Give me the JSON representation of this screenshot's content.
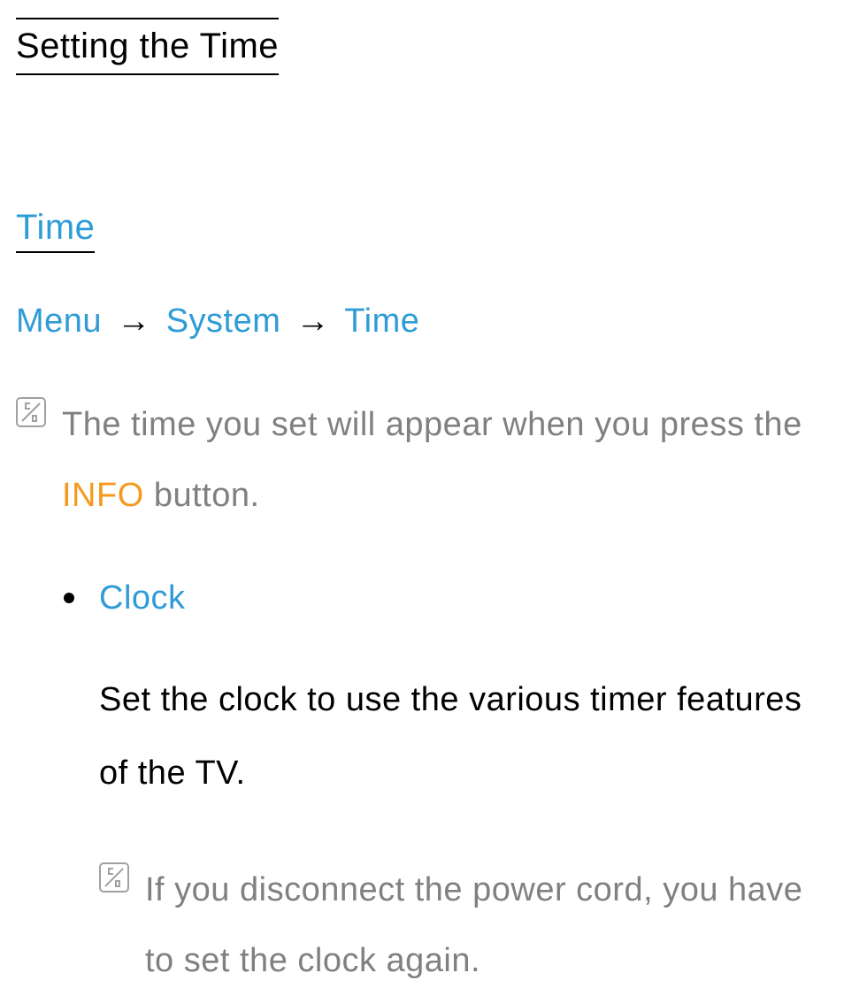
{
  "page": {
    "title": "Setting the Time"
  },
  "section": {
    "title": "Time"
  },
  "breadcrumb": {
    "items": [
      "Menu",
      "System",
      "Time"
    ],
    "arrow": "→"
  },
  "note1": {
    "text_before": "The time you set will appear when you press the ",
    "highlight": "INFO",
    "text_after": " button."
  },
  "bullet": {
    "title": "Clock",
    "body": "Set the clock to use the various timer features of the TV."
  },
  "note2": {
    "text": "If you disconnect the power cord, you have to set the clock again."
  }
}
